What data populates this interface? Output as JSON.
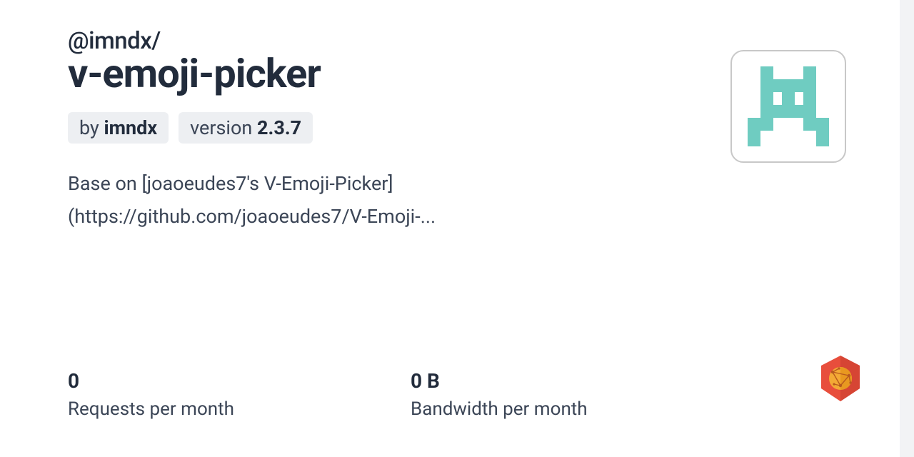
{
  "scope": "@imndx/",
  "packageName": "v-emoji-picker",
  "author": {
    "prefix": "by ",
    "name": "imndx"
  },
  "version": {
    "prefix": "version ",
    "number": "2.3.7"
  },
  "description": "Base on [joaoeudes7's V-Emoji-Picker](https://github.com/joaoeudes7/V-Emoji-...",
  "stats": {
    "requests": {
      "value": "0",
      "label": "Requests per month"
    },
    "bandwidth": {
      "value": "0 B",
      "label": "Bandwidth per month"
    }
  }
}
